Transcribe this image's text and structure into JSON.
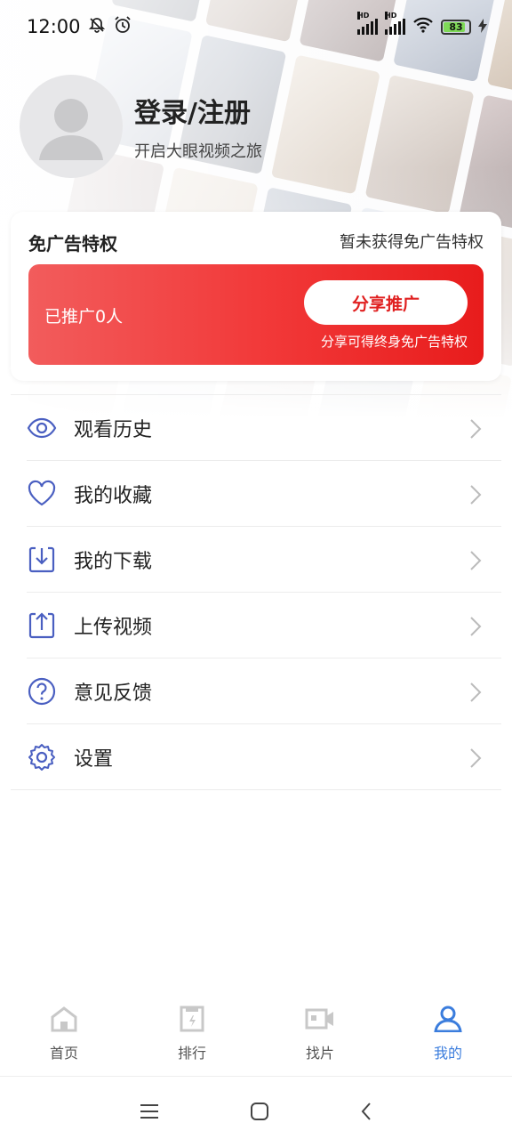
{
  "status_bar": {
    "time": "12:00",
    "battery_level": "83",
    "network_badge": "HD"
  },
  "profile": {
    "login_title": "登录/注册",
    "login_subtitle": "开启大眼视频之旅"
  },
  "ad_free": {
    "title": "免广告特权",
    "status": "暂未获得免广告特权",
    "promoted_count": "已推广0人",
    "share_button": "分享推广",
    "share_note": "分享可得终身免广告特权"
  },
  "menu": [
    {
      "label": "观看历史",
      "icon": "eye-icon"
    },
    {
      "label": "我的收藏",
      "icon": "heart-icon"
    },
    {
      "label": "我的下载",
      "icon": "download-icon"
    },
    {
      "label": "上传视频",
      "icon": "upload-icon"
    },
    {
      "label": "意见反馈",
      "icon": "question-icon"
    },
    {
      "label": "设置",
      "icon": "gear-icon"
    }
  ],
  "bottom_nav": [
    {
      "label": "首页",
      "icon": "home-icon",
      "active": false
    },
    {
      "label": "排行",
      "icon": "ranking-icon",
      "active": false
    },
    {
      "label": "找片",
      "icon": "video-camera-icon",
      "active": false
    },
    {
      "label": "我的",
      "icon": "user-icon",
      "active": true
    }
  ],
  "colors": {
    "accent": "#3b7ddd",
    "menu_icon": "#4a5fc1",
    "banner_red": "#f23a3a",
    "share_text": "#e02020"
  }
}
